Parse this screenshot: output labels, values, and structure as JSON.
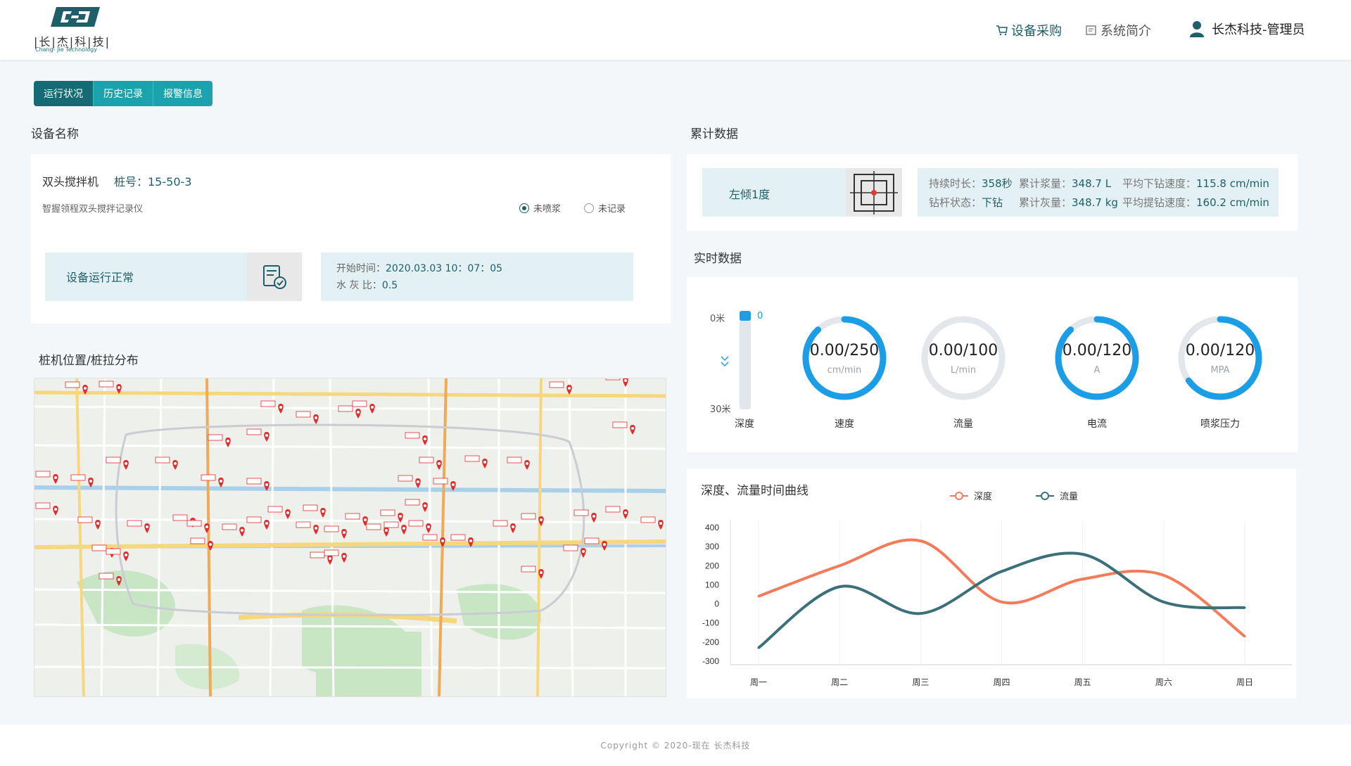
{
  "header": {
    "logo_chars": "|长|杰|科|技|",
    "logo_en": "Chang- Jie Technology",
    "nav_shop": "设备采购",
    "nav_intro": "系统简介",
    "user": "长杰科技-管理员"
  },
  "tabs": [
    {
      "label": "运行状况"
    },
    {
      "label": "历史记录"
    },
    {
      "label": "报警信息"
    }
  ],
  "device": {
    "section_title": "设备名称",
    "name": "双头搅拌机",
    "pile": "桩号：15-50-3",
    "desc": "智握领程双头搅拌记录仪",
    "radio1": "未喷浆",
    "radio2": "未记录",
    "status": "设备运行正常",
    "start_label": "开始时间：",
    "start_value": "2020.03.03   10：07：05",
    "ratio_label": "水 灰 比：",
    "ratio_value": "0.5"
  },
  "map": {
    "section_title": "桩机位置/桩拉分布"
  },
  "cumulative": {
    "section_title": "累计数据",
    "tilt": "左倾1度",
    "duration_label": "持续时长：",
    "duration_value": "358秒",
    "slurry_label": "累计浆量：",
    "slurry_value": "348.7 L",
    "down_speed_label": "平均下钻速度：",
    "down_speed_value": "115.8 cm/min",
    "rod_label": "钻杆状态：",
    "rod_value": "下钻",
    "ash_label": "累计灰量：",
    "ash_value": "348.7 kg",
    "up_speed_label": "平均提钻速度：",
    "up_speed_value": "160.2 cm/min"
  },
  "realtime": {
    "section_title": "实时数据",
    "depth_top": "0米",
    "depth_bottom": "30米",
    "depth_current": "0",
    "depth_label": "深度",
    "gauges": [
      {
        "value": "0.00/250",
        "unit": "cm/min",
        "label": "速度",
        "fraction": 0.88,
        "color": "#1b9ee6"
      },
      {
        "value": "0.00/100",
        "unit": "L/min",
        "label": "流量",
        "fraction": 0,
        "color": "#1b9ee6"
      },
      {
        "value": "0.00/120",
        "unit": "A",
        "label": "电流",
        "fraction": 0.88,
        "color": "#1b9ee6"
      },
      {
        "value": "0.00/120",
        "unit": "MPA",
        "label": "喷浆压力",
        "fraction": 0.65,
        "color": "#1b9ee6"
      }
    ]
  },
  "chart": {
    "section_title": "深度、流量时间曲线"
  },
  "chart_data": {
    "type": "line",
    "categories": [
      "周一",
      "周二",
      "周三",
      "周四",
      "周五",
      "周六",
      "周日"
    ],
    "ylim": [
      -300,
      400
    ],
    "yticks": [
      400,
      300,
      200,
      100,
      0,
      -100,
      -200,
      -300
    ],
    "series": [
      {
        "name": "深度",
        "color": "#f47b5a",
        "values": [
          40,
          200,
          330,
          10,
          130,
          150,
          -170
        ]
      },
      {
        "name": "流量",
        "color": "#3a7079",
        "values": [
          -230,
          90,
          -50,
          170,
          260,
          10,
          -20
        ]
      }
    ]
  },
  "footer": {
    "copyright": "Copyright © 2020-现在 长杰科技"
  }
}
